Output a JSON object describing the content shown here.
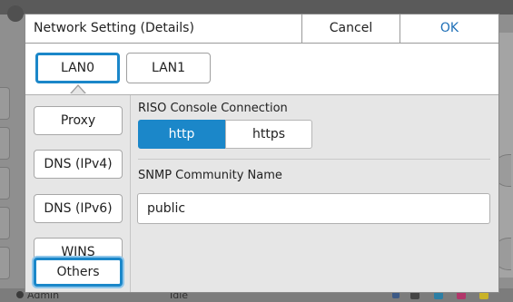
{
  "dialog": {
    "title": "Network Setting (Details)",
    "cancel_label": "Cancel",
    "ok_label": "OK"
  },
  "lan_tabs": [
    {
      "label": "LAN0",
      "selected": true
    },
    {
      "label": "LAN1",
      "selected": false
    }
  ],
  "sidebar": {
    "items": [
      {
        "label": "Proxy",
        "selected": false
      },
      {
        "label": "DNS (IPv4)",
        "selected": false
      },
      {
        "label": "DNS (IPv6)",
        "selected": false
      },
      {
        "label": "WINS",
        "selected": false
      },
      {
        "label": "Others",
        "selected": true
      }
    ]
  },
  "riso_console": {
    "label": "RISO Console Connection",
    "options": [
      "http",
      "https"
    ],
    "selected": "http"
  },
  "snmp": {
    "label": "SNMP Community Name",
    "value": "public"
  },
  "statusbar": {
    "user": "Admin",
    "state": "Idle",
    "inks": [
      "K",
      "C",
      "M",
      "Y"
    ]
  },
  "colors": {
    "accent": "#1b87c9",
    "ok_text": "#1e6fb7",
    "panel_bg": "#e6e6e6",
    "dim_bg": "#8f8f8f"
  }
}
